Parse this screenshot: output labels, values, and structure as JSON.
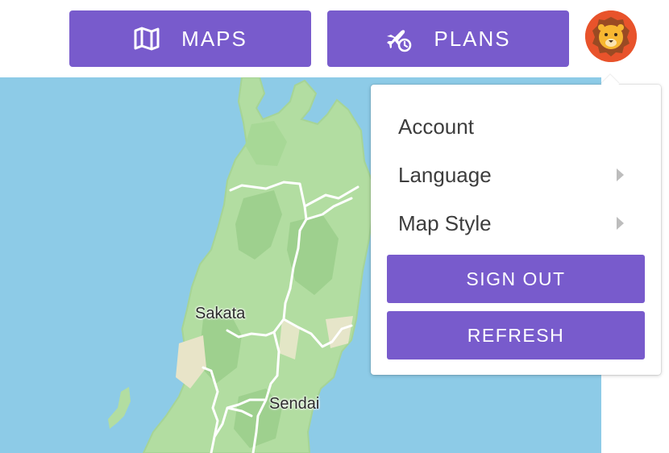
{
  "header": {
    "maps_label": "MAPS",
    "plans_label": "PLANS",
    "maps_icon": "folded-map-icon",
    "plans_icon": "airplane-clock-icon"
  },
  "avatar": {
    "icon": "lion-avatar-icon"
  },
  "map": {
    "labels": {
      "sakata": "Sakata",
      "sendai": "Sendai"
    }
  },
  "user_menu": {
    "items": [
      {
        "label": "Account"
      },
      {
        "label": "Language"
      },
      {
        "label": "Map Style"
      }
    ],
    "sign_out_label": "SIGN OUT",
    "refresh_label": "REFRESH"
  },
  "colors": {
    "accent": "#785bcc",
    "water": "#8dcbe7",
    "land": "#b2dda1"
  }
}
